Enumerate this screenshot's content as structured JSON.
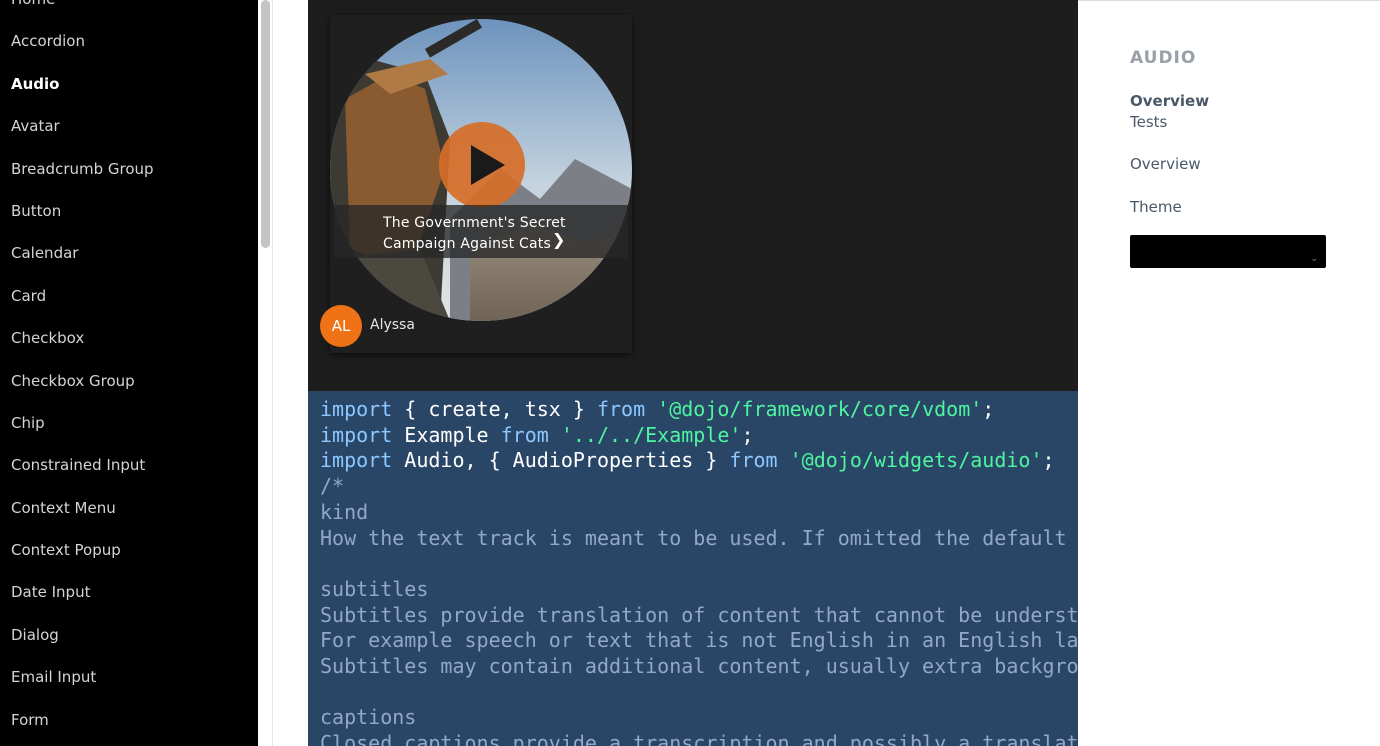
{
  "sidebar": {
    "items": [
      {
        "label": "Home"
      },
      {
        "label": "Accordion"
      },
      {
        "label": "Audio"
      },
      {
        "label": "Avatar"
      },
      {
        "label": "Breadcrumb Group"
      },
      {
        "label": "Button"
      },
      {
        "label": "Calendar"
      },
      {
        "label": "Card"
      },
      {
        "label": "Checkbox"
      },
      {
        "label": "Checkbox Group"
      },
      {
        "label": "Chip"
      },
      {
        "label": "Constrained Input"
      },
      {
        "label": "Context Menu"
      },
      {
        "label": "Context Popup"
      },
      {
        "label": "Date Input"
      },
      {
        "label": "Dialog"
      },
      {
        "label": "Email Input"
      },
      {
        "label": "Form"
      }
    ],
    "active": "Audio"
  },
  "demo": {
    "track_title": "The Government's Secret Campaign Against Cats",
    "author_initials": "AL",
    "author_name": "Alyssa",
    "play_icon": "play-icon",
    "chevron_icon": "chevron-right-icon",
    "accent_color": "#f07216"
  },
  "code": {
    "lines": [
      "import { create, tsx } from '@dojo/framework/core/vdom';",
      "import Example from '../../Example';",
      "import Audio, { AudioProperties } from '@dojo/widgets/audio';",
      "/*",
      "kind",
      "How the text track is meant to be used. If omitted the default kind is sub",
      "",
      "subtitles",
      "Subtitles provide translation of content that cannot be understood by the",
      "For example speech or text that is not English in an English language film.",
      "Subtitles may contain additional content, usually extra background informa",
      "",
      "captions",
      "Closed captions provide a transcription and possibly a translation of audi"
    ]
  },
  "right_panel": {
    "heading": "AUDIO",
    "overview_active": "Overview",
    "tests": "Tests",
    "overview": "Overview",
    "theme_label": "Theme",
    "theme_value": ""
  }
}
